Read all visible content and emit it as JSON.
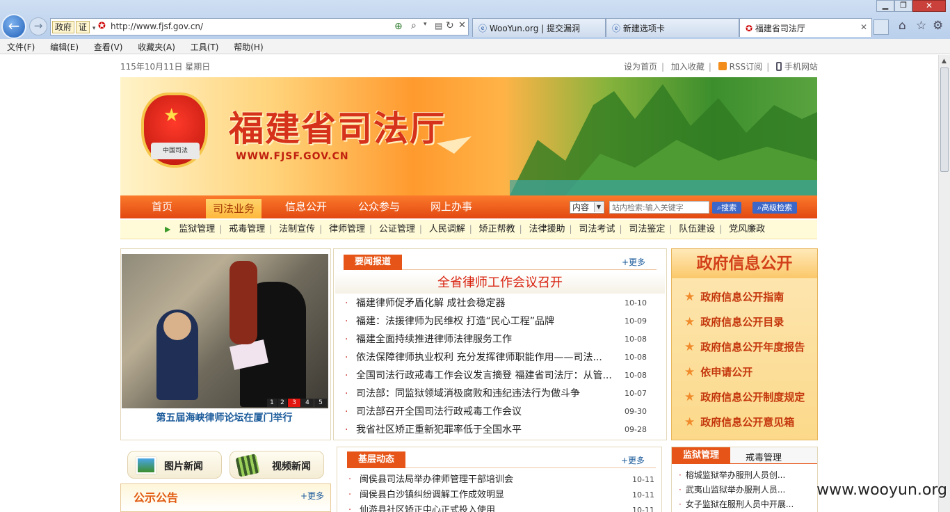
{
  "browser": {
    "address_badge": "政府",
    "address_badge2": "证",
    "url": "http://www.fjsf.gov.cn/",
    "tabs": [
      {
        "label": "WooYun.org | 提交漏洞"
      },
      {
        "label": "新建选项卡"
      },
      {
        "label": "福建省司法厅"
      }
    ],
    "menu": [
      "文件(F)",
      "编辑(E)",
      "查看(V)",
      "收藏夹(A)",
      "工具(T)",
      "帮助(H)"
    ]
  },
  "topbar": {
    "date": "115年10月11日  星期日",
    "links": [
      "设为首页",
      "加入收藏",
      "RSS订阅",
      "手机网站"
    ]
  },
  "banner": {
    "title": "福建省司法厅",
    "url": "WWW.FJSF.GOV.CN",
    "emblem_text": "中国司法"
  },
  "nav": {
    "items": [
      "首页",
      "司法业务",
      "信息公开",
      "公众参与",
      "网上办事"
    ],
    "search_scope": "内容",
    "search_placeholder": "站内检索:输入关键字",
    "search_button": "搜索",
    "advanced_button": "高级检索"
  },
  "subnav": [
    "监狱管理",
    "戒毒管理",
    "法制宣传",
    "律师管理",
    "公证管理",
    "人民调解",
    "矫正帮教",
    "法律援助",
    "司法考试",
    "司法鉴定",
    "队伍建设",
    "党风廉政"
  ],
  "photo": {
    "caption": "第五届海峡律师论坛在厦门举行",
    "pages": [
      "1",
      "2",
      "3",
      "4",
      "5"
    ],
    "active_page": "3"
  },
  "news": {
    "tab": "要闻报道",
    "more": "+更多",
    "headline": "全省律师工作会议召开",
    "items": [
      {
        "title": "福建律师促矛盾化解 成社会稳定器",
        "date": "10-10"
      },
      {
        "title": "福建：法援律师为民维权 打造“民心工程”品牌",
        "date": "10-09"
      },
      {
        "title": "福建全面持续推进律师法律服务工作",
        "date": "10-08"
      },
      {
        "title": "依法保障律师执业权利 充分发挥律师职能作用——司法...",
        "date": "10-08"
      },
      {
        "title": "全国司法行政戒毒工作会议发言摘登 福建省司法厅：从管...",
        "date": "10-08"
      },
      {
        "title": "司法部：同监狱领域消极腐败和违纪违法行为做斗争",
        "date": "10-07"
      },
      {
        "title": "司法部召开全国司法行政戒毒工作会议",
        "date": "09-30"
      },
      {
        "title": "我省社区矫正重新犯罪率低于全国水平",
        "date": "09-28"
      }
    ]
  },
  "gov_info": {
    "title": "政府信息公开",
    "items": [
      "政府信息公开指南",
      "政府信息公开目录",
      "政府信息公开年度报告",
      "依申请公开",
      "政府信息公开制度规定",
      "政府信息公开意见箱"
    ]
  },
  "media": {
    "photo_news": "图片新闻",
    "video_news": "视频新闻"
  },
  "notice": {
    "title": "公示公告",
    "more": "+更多"
  },
  "grassroots": {
    "tab": "基层动态",
    "more": "+更多",
    "items": [
      {
        "title": "闽侯县司法局举办律师管理干部培训会",
        "date": "10-11"
      },
      {
        "title": "闽侯县白沙镇纠纷调解工作成效明显",
        "date": "10-11"
      },
      {
        "title": "仙游县社区矫正中心正式投入使用",
        "date": "10-11"
      }
    ]
  },
  "prison": {
    "tab_active": "监狱管理",
    "tab_other": "戒毒管理",
    "items": [
      "榕城监狱举办服刑人员创...",
      "武夷山监狱举办服刑人员...",
      "女子监狱在服刑人员中开展..."
    ]
  },
  "watermark": "www.wooyun.org",
  "colors": {
    "brand": "#e24812",
    "accent": "#c4370d",
    "star": "#f08a2a"
  }
}
